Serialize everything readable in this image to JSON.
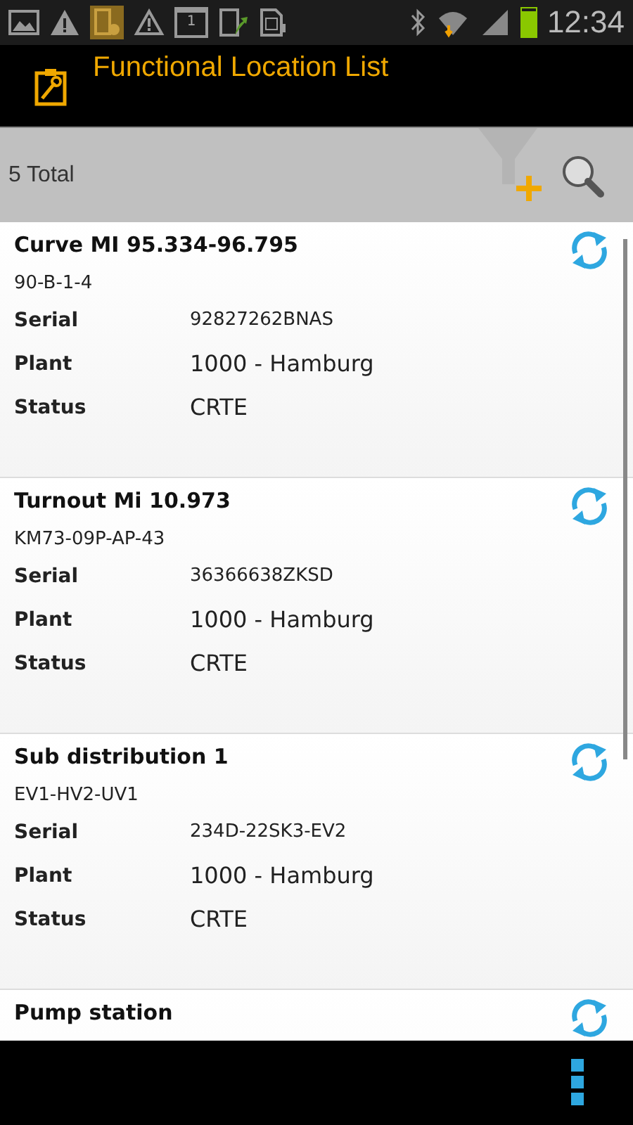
{
  "status_bar": {
    "calendar_day": "1",
    "time": "12:34"
  },
  "action_bar": {
    "title": "Functional Location List"
  },
  "toolbar": {
    "count": "5 Total"
  },
  "items": [
    {
      "title": "Curve MI 95.334-96.795",
      "code": "90-B-1-4",
      "fields": [
        {
          "label": "Serial",
          "value": "92827262BNAS",
          "kind": "small"
        },
        {
          "label": "Plant",
          "value": "1000 - Hamburg",
          "kind": "large"
        },
        {
          "label": "Status",
          "value": "CRTE",
          "kind": "large"
        }
      ]
    },
    {
      "title": "Turnout Mi 10.973",
      "code": "KM73-09P-AP-43",
      "fields": [
        {
          "label": "Serial",
          "value": "36366638ZKSD",
          "kind": "small"
        },
        {
          "label": "Plant",
          "value": "1000 - Hamburg",
          "kind": "large"
        },
        {
          "label": "Status",
          "value": "CRTE",
          "kind": "large"
        }
      ]
    },
    {
      "title": "Sub distribution 1",
      "code": "EV1-HV2-UV1",
      "fields": [
        {
          "label": "Serial",
          "value": "234D-22SK3-EV2",
          "kind": "small"
        },
        {
          "label": "Plant",
          "value": "1000 - Hamburg",
          "kind": "large"
        },
        {
          "label": "Status",
          "value": "CRTE",
          "kind": "large"
        }
      ]
    },
    {
      "title": "Pump station"
    }
  ]
}
